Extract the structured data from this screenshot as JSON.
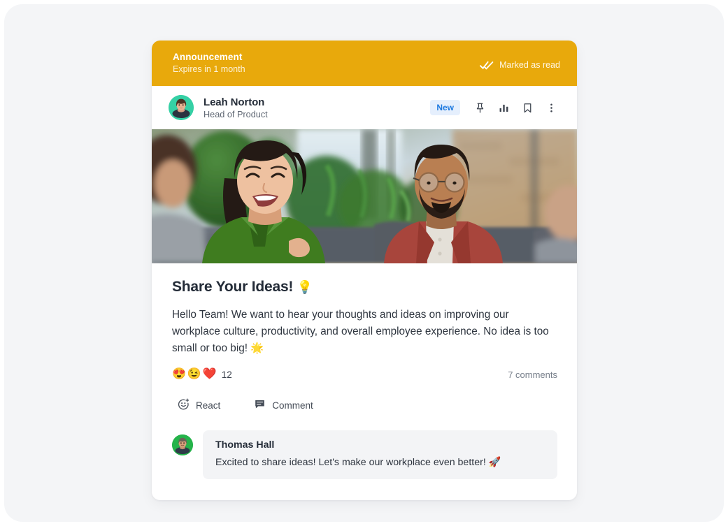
{
  "banner": {
    "title": "Announcement",
    "subtitle": "Expires in 1 month",
    "read_status": "Marked as read",
    "read_icon": "double-check-icon",
    "background_color": "#e8a90c"
  },
  "post_header": {
    "author_name": "Leah Norton",
    "author_role": "Head of Product",
    "avatar_icon": "avatar-leah-norton",
    "avatar_background": "#35d0a5",
    "badge": {
      "label": "New",
      "text_color": "#1f7ae0",
      "background_color": "#e5effd"
    },
    "actions": [
      {
        "name": "pin-icon",
        "title": "Pin"
      },
      {
        "name": "poll-icon",
        "title": "Poll results"
      },
      {
        "name": "bookmark-icon",
        "title": "Save"
      },
      {
        "name": "more-vertical-icon",
        "title": "More options"
      }
    ]
  },
  "hero": {
    "alt": "Three colleagues talking and laughing in a bright office with plants"
  },
  "post": {
    "title": "Share Your Ideas!",
    "title_emoji": "💡",
    "text": "Hello Team! We want to hear your thoughts and ideas on improving our workplace culture, productivity, and overall employee experience. No idea is too small or too big! 🌟",
    "reactions": [
      {
        "emoji": "😍",
        "name": "heart-eyes-reaction"
      },
      {
        "emoji": "😉",
        "name": "winking-face-reaction"
      },
      {
        "emoji": "❤️",
        "name": "heart-reaction"
      }
    ],
    "reaction_count": "12",
    "comments_count": "7 comments"
  },
  "action_bar": {
    "react_label": "React",
    "react_icon": "add-reaction-icon",
    "comment_label": "Comment",
    "comment_icon": "comment-icon"
  },
  "comment": {
    "author": "Thomas Hall",
    "text": "Excited to share ideas! Let's make our workplace even better! 🚀",
    "avatar_icon": "avatar-thomas-hall",
    "avatar_background": "#25b34a"
  },
  "theme": {
    "page_background": "#f4f5f7",
    "card_background": "#ffffff",
    "text_primary": "#242c38",
    "text_secondary": "#5f6773",
    "accent_yellow": "#e8a90c",
    "accent_blue": "#1f7ae0"
  }
}
